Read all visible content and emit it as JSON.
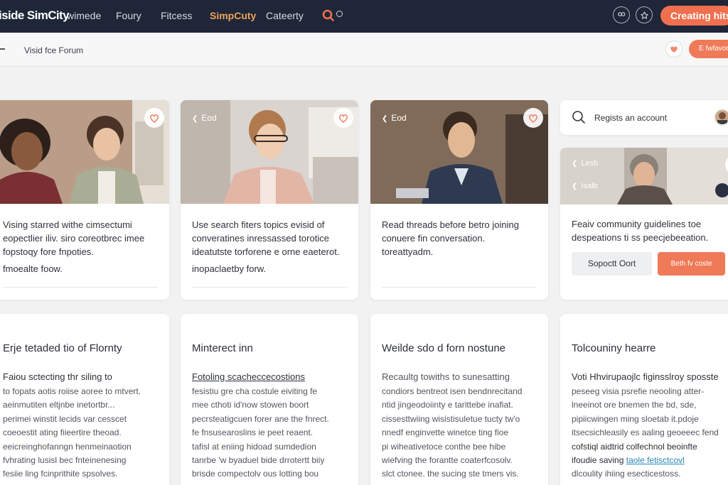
{
  "nav": {
    "logo": "iside SimCity",
    "links": [
      {
        "label": "wimede"
      },
      {
        "label": "Foury"
      },
      {
        "label": "Fitcess"
      },
      {
        "label": "SimpCuty"
      },
      {
        "label": "Cateerty"
      }
    ],
    "cta_label": "Creating hits",
    "accent_color": "#ef6f4f",
    "background_color": "#1e2638"
  },
  "subheader": {
    "breadcrumb": "Visid fce Forum",
    "pill_label": "E fwfavor"
  },
  "cards": [
    {
      "text": [
        "Vising starred withe cimsectumi",
        "eopectlier iliv. siro coreotbrec imee",
        "fopstoqy fore fnpoties."
      ],
      "meta": "fmoealte foow."
    },
    {
      "tag": "Eod",
      "text": [
        "Use search fiters topics evisid of",
        "converatines inressassed torotice",
        "ideatutste torforene e orne eaeterot."
      ],
      "meta": "inopaclaetby forw."
    },
    {
      "tag": "Eod",
      "text": [
        "Read threads before betro joining",
        "conuere fin conversation.",
        "toreattyadm."
      ]
    }
  ],
  "side": {
    "search_label": "Regists an account",
    "photo_tags": [
      "Lesb",
      "Isalb"
    ],
    "guideline_text": [
      "Feaiv community guidelines toe",
      "despeations ti ss peecjebeeation."
    ],
    "ghost_button": "Sopoctt Oort",
    "accent_button": "Beth fv coste"
  },
  "lower_cards": [
    {
      "title": "Erje tetaded tio of Flornty",
      "subtitle": "Faiou sctecting thr siling to",
      "body": [
        "to fopats aotis roiise aoree to mtvert.",
        "aeinmutiten eltjnbe inetortbr...",
        "perimei winstit lecids var cesscet",
        "coeoestit ating fiieertire theoad.",
        "eeicreinghofanngn henmeinaotion",
        "fvhrating lusisl bec fnteinenesing",
        "fesiie ling fcinprithite spsolves."
      ]
    },
    {
      "title": "Minterect inn",
      "subtitle": "Fotoling scacheccecostions",
      "body": [
        "fesistiu gre cha costule eiviting fe",
        "mee cthoti id'now stowen boort",
        "pecrsteatigcuen forer ane the fnrect.",
        "fe fnsusearoslins ie peet reaent.",
        "tafisl at eniing hidoad sumdedion",
        "tanrbe 'w byaduel bide drrotertt biiy",
        "brisde compectolv ous lotting bou"
      ]
    },
    {
      "title": "Weilde sdo d forn nostune",
      "subtitle": "Recaultg towiths to sunesatting",
      "body": [
        "condiors bentreot isen bendnrecitand",
        "ntid jingeodoiinty e tarittebe inafiat.",
        "cissesttwiing wisistisuletue tucty tw'o",
        "nnedf enginvette winetce ting fioe",
        "pi wiheativetoce conthe bee hibe",
        "wiefving the forantte coaterfcosolv.",
        "slct ctonee. the sucing ste tmers vis."
      ]
    },
    {
      "title": "Tolcouniny hearre",
      "subtitle": "Voti Hhvirupaojlc figinsslroy sposste",
      "body": [
        "peseeg visia psrefie neooling atter-",
        "lneeinot ore bnemen the bd, sde,",
        "pipiicwingen ming sloetab it.pdoje",
        "itsecsichleasily es aaling geoeeec fend",
        "cofstiql aidtrid colfechnol beoinfte",
        "ifoudie saving",
        "dlcoulity ihiing esecticestoss."
      ],
      "link_text": "taole fetisctcovl"
    }
  ]
}
